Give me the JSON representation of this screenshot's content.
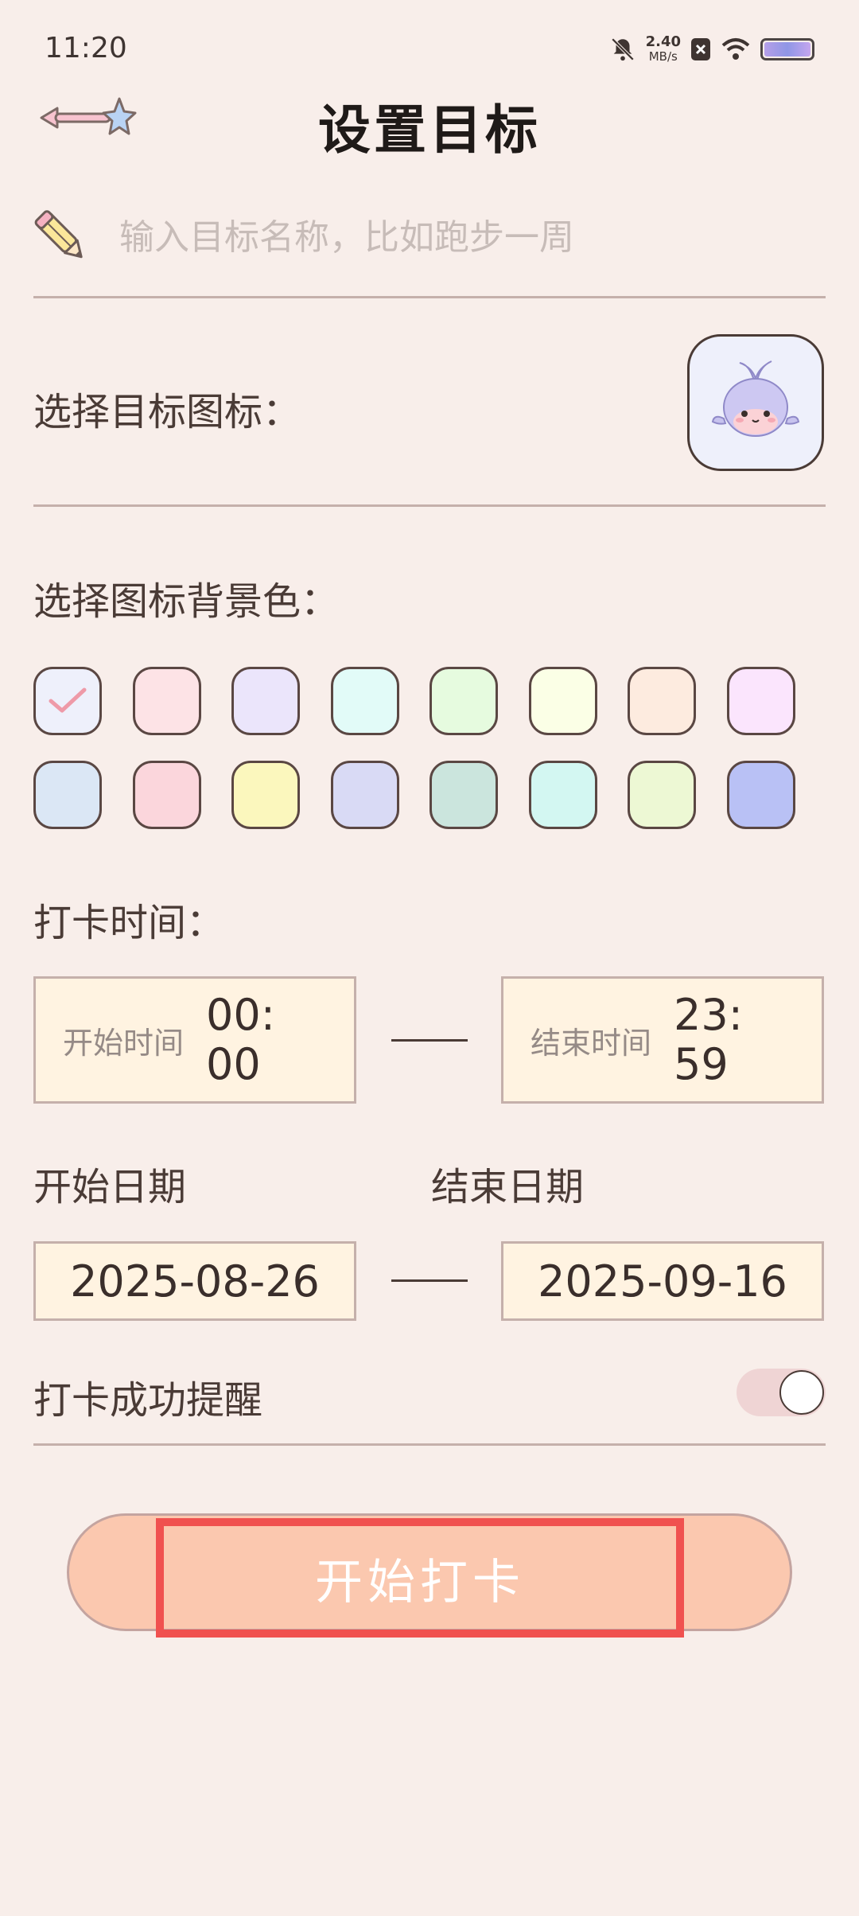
{
  "status_bar": {
    "time": "11:20",
    "net_speed": "2.40",
    "net_unit": "MB/s"
  },
  "header": {
    "title": "设置目标"
  },
  "goal_name": {
    "placeholder": "输入目标名称，比如跑步一周",
    "value": ""
  },
  "icon_section": {
    "label": "选择目标图标：",
    "selected_icon": "whale-icon"
  },
  "color_section": {
    "label": "选择图标背景色：",
    "selected_index": 0,
    "colors": [
      "#eef0fb",
      "#fde3e6",
      "#ebe5fb",
      "#e2fbf8",
      "#e6fbdf",
      "#fbffe6",
      "#fdebdf",
      "#fbe5fd",
      "#dbe7f5",
      "#fbd6dc",
      "#fbf7bd",
      "#d9daf5",
      "#cbe5dd",
      "#d3f7f2",
      "#edf8d4",
      "#b9c1f5"
    ]
  },
  "time_section": {
    "label": "打卡时间：",
    "start_label": "开始时间",
    "start_value": "00:00",
    "end_label": "结束时间",
    "end_value": "23:59"
  },
  "date_section": {
    "start_label": "开始日期",
    "end_label": "结束日期",
    "start_value": "2025-08-26",
    "end_value": "2025-09-16"
  },
  "reminder": {
    "label": "打卡成功提醒",
    "enabled": false
  },
  "action": {
    "start_label": "开始打卡"
  }
}
